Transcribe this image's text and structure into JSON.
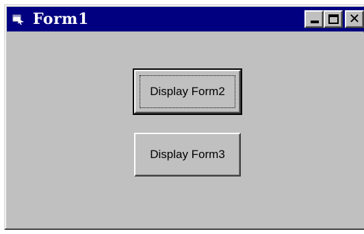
{
  "window": {
    "title": "Form1",
    "title_bar_color": "#000080",
    "face_color": "#c0c0c0",
    "icons": {
      "app": "form-icon",
      "minimize": "minimize-icon",
      "maximize": "maximize-icon",
      "close": "close-icon"
    },
    "close_glyph": "✕"
  },
  "buttons": [
    {
      "label": "Display Form2",
      "focused": true
    },
    {
      "label": "Display Form3",
      "focused": false
    }
  ]
}
